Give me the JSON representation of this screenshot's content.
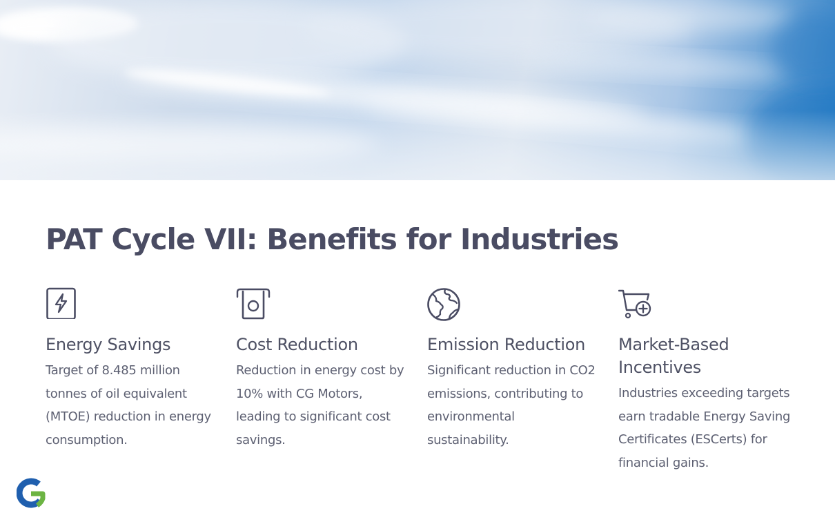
{
  "slide": {
    "title": "PAT Cycle VII: Benefits for Industries"
  },
  "colors": {
    "title": "#4a4c63",
    "heading": "#4e5164",
    "body": "#5d6072",
    "icon": "#4a4c63",
    "logo_blue": "#1f5fae",
    "logo_green": "#6cb443"
  },
  "cards": [
    {
      "icon": "lightning-box-icon",
      "heading": "Energy Savings",
      "body": "Target of 8.485 million tonnes of oil equivalent (MTOE) reduction in energy consumption."
    },
    {
      "icon": "coin-slot-icon",
      "heading": "Cost Reduction",
      "body": "Reduction in energy cost by 10% with CG Motors, leading to significant cost savings."
    },
    {
      "icon": "globe-icon",
      "heading": "Emission Reduction",
      "body": "Significant reduction in CO2 emissions, contributing to environmental sustainability."
    },
    {
      "icon": "cart-plus-icon",
      "heading": "Market-Based Incentives",
      "body": "Industries exceeding targets earn tradable Energy Saving Certificates (ESCerts) for financial gains."
    }
  ],
  "logo": {
    "icon": "cg-logo-icon"
  }
}
